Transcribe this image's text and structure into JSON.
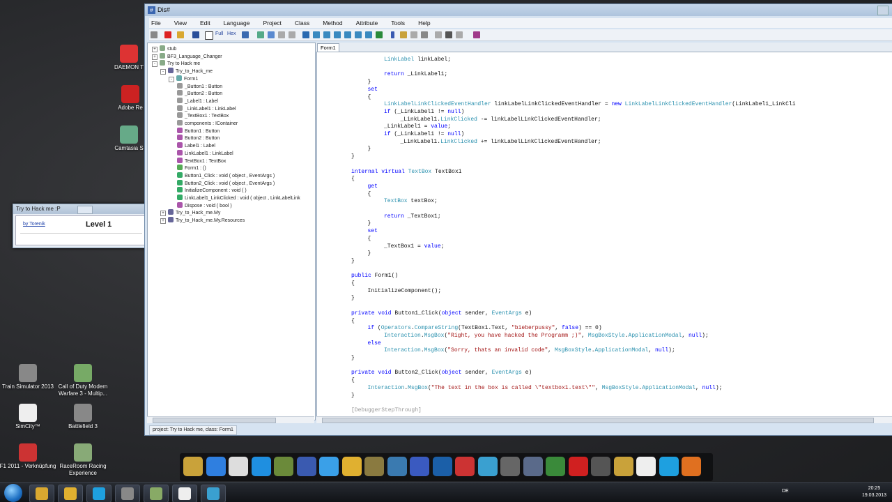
{
  "desktop_icons": [
    {
      "label": "DAEMON T",
      "color": "#d33"
    },
    {
      "label": "Adobe Re",
      "color": "#c22"
    },
    {
      "label": "Camtasia S",
      "color": "#6a8"
    },
    {
      "label": "Train Simulator 2013",
      "color": "#888"
    },
    {
      "label": "Call of Duty Modern Warfare 3 - Multip...",
      "color": "#7a6"
    },
    {
      "label": "SimCity™",
      "color": "#eee"
    },
    {
      "label": "Battlefield 3",
      "color": "#888"
    },
    {
      "label": "F1 2011 - Verknüpfung",
      "color": "#c33"
    },
    {
      "label": "RaceRoom Racing Experience",
      "color": "#8a7"
    }
  ],
  "mini_window": {
    "title": "Try to Hack me :P",
    "link": "by Torenik",
    "level": "Level 1"
  },
  "window": {
    "title": "Dis#"
  },
  "menu": [
    "File",
    "View",
    "Edit",
    "Language",
    "Project",
    "Class",
    "Method",
    "Attribute",
    "Tools",
    "Help"
  ],
  "toolbar": {
    "full": "Full",
    "hex": "Hex"
  },
  "tree": [
    {
      "label": "stub",
      "depth": 0,
      "pm": "+",
      "icon": "#8a8"
    },
    {
      "label": "BF3_Language_Changer",
      "depth": 0,
      "pm": "+",
      "icon": "#8a8"
    },
    {
      "label": "Try to Hack me",
      "depth": 0,
      "pm": "-",
      "icon": "#8a8"
    },
    {
      "label": "Try_to_Hack_me",
      "depth": 1,
      "pm": "-",
      "icon": "#669"
    },
    {
      "label": "Form1",
      "depth": 2,
      "pm": "-",
      "icon": "#6aa"
    },
    {
      "label": "_Button1 : Button",
      "depth": 3,
      "icon": "#999"
    },
    {
      "label": "_Button2 : Button",
      "depth": 3,
      "icon": "#999"
    },
    {
      "label": "_Label1 : Label",
      "depth": 3,
      "icon": "#999"
    },
    {
      "label": "_LinkLabel1 : LinkLabel",
      "depth": 3,
      "icon": "#999"
    },
    {
      "label": "_TextBox1 : TextBox",
      "depth": 3,
      "icon": "#999"
    },
    {
      "label": "components : IContainer",
      "depth": 3,
      "icon": "#999"
    },
    {
      "label": "Button1 : Button",
      "depth": 3,
      "icon": "#a5a"
    },
    {
      "label": "Button2 : Button",
      "depth": 3,
      "icon": "#a5a"
    },
    {
      "label": "Label1 : Label",
      "depth": 3,
      "icon": "#a5a"
    },
    {
      "label": "LinkLabel1 : LinkLabel",
      "depth": 3,
      "icon": "#a5a"
    },
    {
      "label": "TextBox1 : TextBox",
      "depth": 3,
      "icon": "#a5a"
    },
    {
      "label": "Form1 : ()",
      "depth": 3,
      "icon": "#5a5"
    },
    {
      "label": "Button1_Click : void ( object , EventArgs )",
      "depth": 3,
      "icon": "#3a6"
    },
    {
      "label": "Button2_Click : void ( object , EventArgs )",
      "depth": 3,
      "icon": "#3a6"
    },
    {
      "label": "InitializeComponent : void ( )",
      "depth": 3,
      "icon": "#3a6"
    },
    {
      "label": "LinkLabel1_LinkClicked : void ( object , LinkLabelLink",
      "depth": 3,
      "icon": "#3a6"
    },
    {
      "label": "Dispose : void ( bool )",
      "depth": 3,
      "icon": "#a5a"
    },
    {
      "label": "Try_to_Hack_me.My",
      "depth": 1,
      "pm": "+",
      "icon": "#669"
    },
    {
      "label": "Try_to_Hack_me.My.Resources",
      "depth": 1,
      "pm": "+",
      "icon": "#669"
    }
  ],
  "editor": {
    "tab": "Form1"
  },
  "code_lines": [
    {
      "indent": 4,
      "html": "<span class='ty'>LinkLabel</span> linkLabel;"
    },
    {
      "indent": 0,
      "html": ""
    },
    {
      "indent": 4,
      "html": "<span class='kw'>return</span> _LinkLabel1;"
    },
    {
      "indent": 3,
      "html": "}"
    },
    {
      "indent": 3,
      "html": "<span class='kw'>set</span>"
    },
    {
      "indent": 3,
      "html": "{"
    },
    {
      "indent": 4,
      "html": "<span class='ty'>LinkLabelLinkClickedEventHandler</span> linkLabelLinkClickedEventHandler = <span class='kw'>new</span> <span class='ty'>LinkLabelLinkClickedEventHandler</span>(LinkLabel1_LinkCli"
    },
    {
      "indent": 4,
      "html": "<span class='kw'>if</span> (_LinkLabel1 != <span class='kw'>null</span>)"
    },
    {
      "indent": 5,
      "html": "_LinkLabel1.<span class='ty'>LinkClicked</span> -= linkLabelLinkClickedEventHandler;"
    },
    {
      "indent": 4,
      "html": "_LinkLabel1 = <span class='kw'>value</span>;"
    },
    {
      "indent": 4,
      "html": "<span class='kw'>if</span> (_LinkLabel1 != <span class='kw'>null</span>)"
    },
    {
      "indent": 5,
      "html": "_LinkLabel1.<span class='ty'>LinkClicked</span> += linkLabelLinkClickedEventHandler;"
    },
    {
      "indent": 3,
      "html": "}"
    },
    {
      "indent": 2,
      "html": "}"
    },
    {
      "indent": 0,
      "html": ""
    },
    {
      "indent": 2,
      "html": "<span class='kw'>internal virtual</span> <span class='ty'>TextBox</span> TextBox1"
    },
    {
      "indent": 2,
      "html": "{"
    },
    {
      "indent": 3,
      "html": "<span class='kw'>get</span>"
    },
    {
      "indent": 3,
      "html": "{"
    },
    {
      "indent": 4,
      "html": "<span class='ty'>TextBox</span> textBox;"
    },
    {
      "indent": 0,
      "html": ""
    },
    {
      "indent": 4,
      "html": "<span class='kw'>return</span> _TextBox1;"
    },
    {
      "indent": 3,
      "html": "}"
    },
    {
      "indent": 3,
      "html": "<span class='kw'>set</span>"
    },
    {
      "indent": 3,
      "html": "{"
    },
    {
      "indent": 4,
      "html": "_TextBox1 = <span class='kw'>value</span>;"
    },
    {
      "indent": 3,
      "html": "}"
    },
    {
      "indent": 2,
      "html": "}"
    },
    {
      "indent": 0,
      "html": ""
    },
    {
      "indent": 2,
      "html": "<span class='kw'>public</span> Form1()"
    },
    {
      "indent": 2,
      "html": "{"
    },
    {
      "indent": 3,
      "html": "InitializeComponent();"
    },
    {
      "indent": 2,
      "html": "}"
    },
    {
      "indent": 0,
      "html": ""
    },
    {
      "indent": 2,
      "html": "<span class='kw'>private void</span> Button1_Click(<span class='kw'>object</span> sender, <span class='ty'>EventArgs</span> e)"
    },
    {
      "indent": 2,
      "html": "{"
    },
    {
      "indent": 3,
      "html": "<span class='kw'>if</span> (<span class='ty'>Operators</span>.<span class='ty'>CompareString</span>(TextBox1.Text, <span class='st'>\"bieberpussy\"</span>, <span class='kw'>false</span>) == 0)"
    },
    {
      "indent": 4,
      "html": "<span class='ty'>Interaction</span>.<span class='ty'>MsgBox</span>(<span class='st'>\"Right, you have hacked the Programm ;)\"</span>, <span class='ty'>MsgBoxStyle</span>.<span class='ty'>ApplicationModal</span>, <span class='kw'>null</span>);"
    },
    {
      "indent": 3,
      "html": "<span class='kw'>else</span>"
    },
    {
      "indent": 4,
      "html": "<span class='ty'>Interaction</span>.<span class='ty'>MsgBox</span>(<span class='st'>\"Sorry, thats an invalid code\"</span>, <span class='ty'>MsgBoxStyle</span>.<span class='ty'>ApplicationModal</span>, <span class='kw'>null</span>);"
    },
    {
      "indent": 2,
      "html": "}"
    },
    {
      "indent": 0,
      "html": ""
    },
    {
      "indent": 2,
      "html": "<span class='kw'>private void</span> Button2_Click(<span class='kw'>object</span> sender, <span class='ty'>EventArgs</span> e)"
    },
    {
      "indent": 2,
      "html": "{"
    },
    {
      "indent": 3,
      "html": "<span class='ty'>Interaction</span>.<span class='ty'>MsgBox</span>(<span class='st'>\"The text in the box is called \\\"textbox1.text\\\"\"</span>, <span class='ty'>MsgBoxStyle</span>.<span class='ty'>ApplicationModal</span>, <span class='kw'>null</span>);"
    },
    {
      "indent": 2,
      "html": "}"
    },
    {
      "indent": 0,
      "html": ""
    },
    {
      "indent": 2,
      "html": "<span class='gy'>[DebuggerStepThrough]</span>"
    }
  ],
  "status": "project: Try to Hack me,  class: Form1",
  "dock_icons": [
    {
      "name": "folder-icon",
      "color": "#c9a23a"
    },
    {
      "name": "hammer-icon",
      "color": "#2f7fe0"
    },
    {
      "name": "notepad-icon",
      "color": "#ddd"
    },
    {
      "name": "teamviewer-icon",
      "color": "#1f8fe0"
    },
    {
      "name": "minecraft-icon",
      "color": "#6b8a3a"
    },
    {
      "name": "vb-icon",
      "color": "#3a5ab0"
    },
    {
      "name": "cloud-icon",
      "color": "#3aa0e8"
    },
    {
      "name": "chrome-icon",
      "color": "#e0b030"
    },
    {
      "name": "syv-icon",
      "color": "#8a7a40"
    },
    {
      "name": "gear-icon",
      "color": "#3a7ab0"
    },
    {
      "name": "globe-icon",
      "color": "#3a5ac0"
    },
    {
      "name": "photoshop-icon",
      "color": "#1b5fa8"
    },
    {
      "name": "save-icon",
      "color": "#c33"
    },
    {
      "name": "dissharp-icon",
      "color": "#3aa0d0"
    },
    {
      "name": "headset-icon",
      "color": "#666"
    },
    {
      "name": "speaker-icon",
      "color": "#5a6a8a"
    },
    {
      "name": "excel-icon",
      "color": "#3a8a3a"
    },
    {
      "name": "star-icon",
      "color": "#d02020"
    },
    {
      "name": "steam-icon",
      "color": "#555"
    },
    {
      "name": "plane-icon",
      "color": "#c9a23a"
    },
    {
      "name": "file-icon",
      "color": "#eee"
    },
    {
      "name": "skype-icon",
      "color": "#1ea0e0"
    },
    {
      "name": "firefox-icon",
      "color": "#e07020"
    }
  ],
  "taskbar_items": [
    {
      "name": "explorer-icon",
      "color": "#d9a830"
    },
    {
      "name": "chrome-icon",
      "color": "#e0b030"
    },
    {
      "name": "skype-icon",
      "color": "#1ea0e0"
    },
    {
      "name": "app-icon",
      "color": "#888"
    },
    {
      "name": "app2-icon",
      "color": "#8a6"
    },
    {
      "name": "window-icon",
      "color": "#eee"
    },
    {
      "name": "dissharp-icon",
      "color": "#3aa0d0"
    }
  ],
  "tray": {
    "lang": "DE",
    "time": "20:25",
    "date": "19.03.2013"
  }
}
